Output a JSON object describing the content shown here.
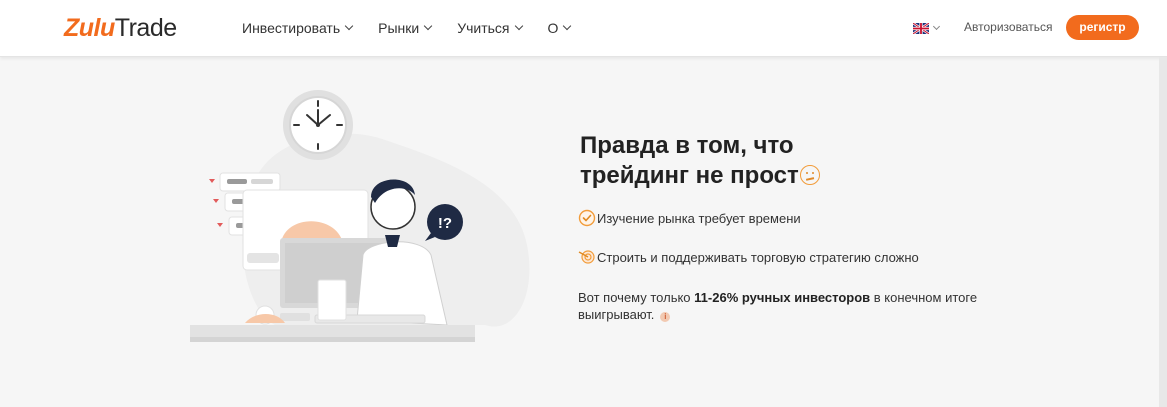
{
  "header": {
    "logo_part1": "Zulu",
    "logo_part2": "Trade",
    "nav": [
      {
        "label": "Инвестировать"
      },
      {
        "label": "Рынки"
      },
      {
        "label": "Учиться"
      },
      {
        "label": "О"
      }
    ],
    "language_icon": "uk-flag-icon",
    "login_label": "Авторизоваться",
    "register_label": "регистр"
  },
  "main": {
    "headline_line1": "Правда в том, что",
    "headline_line2": "трейдинг не прост",
    "points": [
      {
        "icon": "clock-check-icon",
        "text": "Изучение рынка требует времени"
      },
      {
        "icon": "target-icon",
        "text": "Строить и поддерживать торговую стратегию сложно"
      }
    ],
    "note_prefix": "Вот почему только ",
    "note_bold": "11-26% ручных инвесторов",
    "note_suffix": " в конечном итоге выигрывают.",
    "info_icon": "i"
  },
  "colors": {
    "brand": "#f26b1d",
    "background": "#f6f6f6",
    "text": "#222222"
  }
}
